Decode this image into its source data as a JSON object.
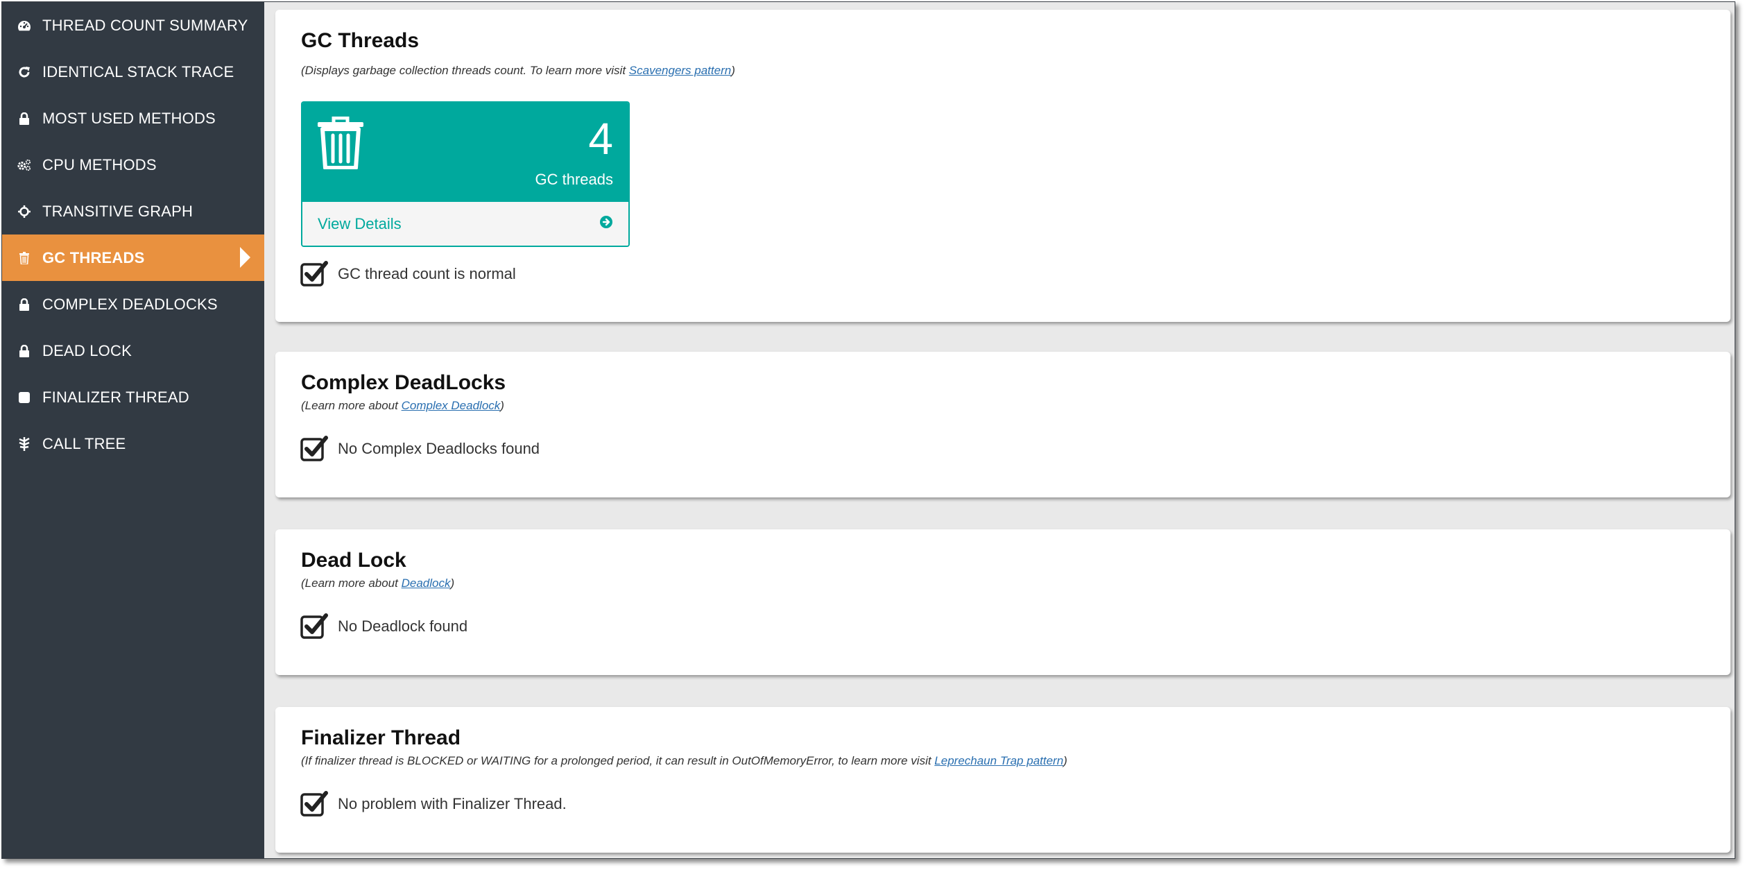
{
  "sidebar": {
    "items": [
      {
        "label": "THREAD COUNT SUMMARY",
        "icon": "dashboard-icon"
      },
      {
        "label": "IDENTICAL STACK TRACE",
        "icon": "refresh-icon"
      },
      {
        "label": "MOST USED METHODS",
        "icon": "lock-icon"
      },
      {
        "label": "CPU METHODS",
        "icon": "gears-icon"
      },
      {
        "label": "TRANSITIVE GRAPH",
        "icon": "crosshair-icon"
      },
      {
        "label": "GC THREADS",
        "icon": "trash-icon",
        "active": true
      },
      {
        "label": "COMPLEX DEADLOCKS",
        "icon": "lock-icon"
      },
      {
        "label": "DEAD LOCK",
        "icon": "lock-icon"
      },
      {
        "label": "FINALIZER THREAD",
        "icon": "square-icon"
      },
      {
        "label": "CALL TREE",
        "icon": "tree-icon"
      }
    ]
  },
  "gc": {
    "title": "GC Threads",
    "desc_prefix": "(Displays garbage collection threads count. To learn more visit ",
    "desc_link": "Scavengers pattern",
    "desc_suffix": ")",
    "count": "4",
    "count_label": "GC threads",
    "view_details": "View Details",
    "status": "GC thread count is normal"
  },
  "complex": {
    "title": "Complex DeadLocks",
    "desc_prefix": "(Learn more about ",
    "desc_link": "Complex Deadlock",
    "desc_suffix": ")",
    "status": "No Complex Deadlocks found"
  },
  "deadlock": {
    "title": "Dead Lock",
    "desc_prefix": "(Learn more about ",
    "desc_link": "Deadlock",
    "desc_suffix": ")",
    "status": "No Deadlock found"
  },
  "finalizer": {
    "title": "Finalizer Thread",
    "desc_prefix": "(If finalizer thread is BLOCKED or WAITING for a prolonged period, it can result in OutOfMemoryError, to learn more visit ",
    "desc_link": "Leprechaun Trap pattern",
    "desc_suffix": ")",
    "status": "No problem with Finalizer Thread."
  },
  "colors": {
    "sidebar_bg": "#323a43",
    "active": "#e9913f",
    "accent": "#00a99d",
    "link": "#2a6fb0"
  }
}
